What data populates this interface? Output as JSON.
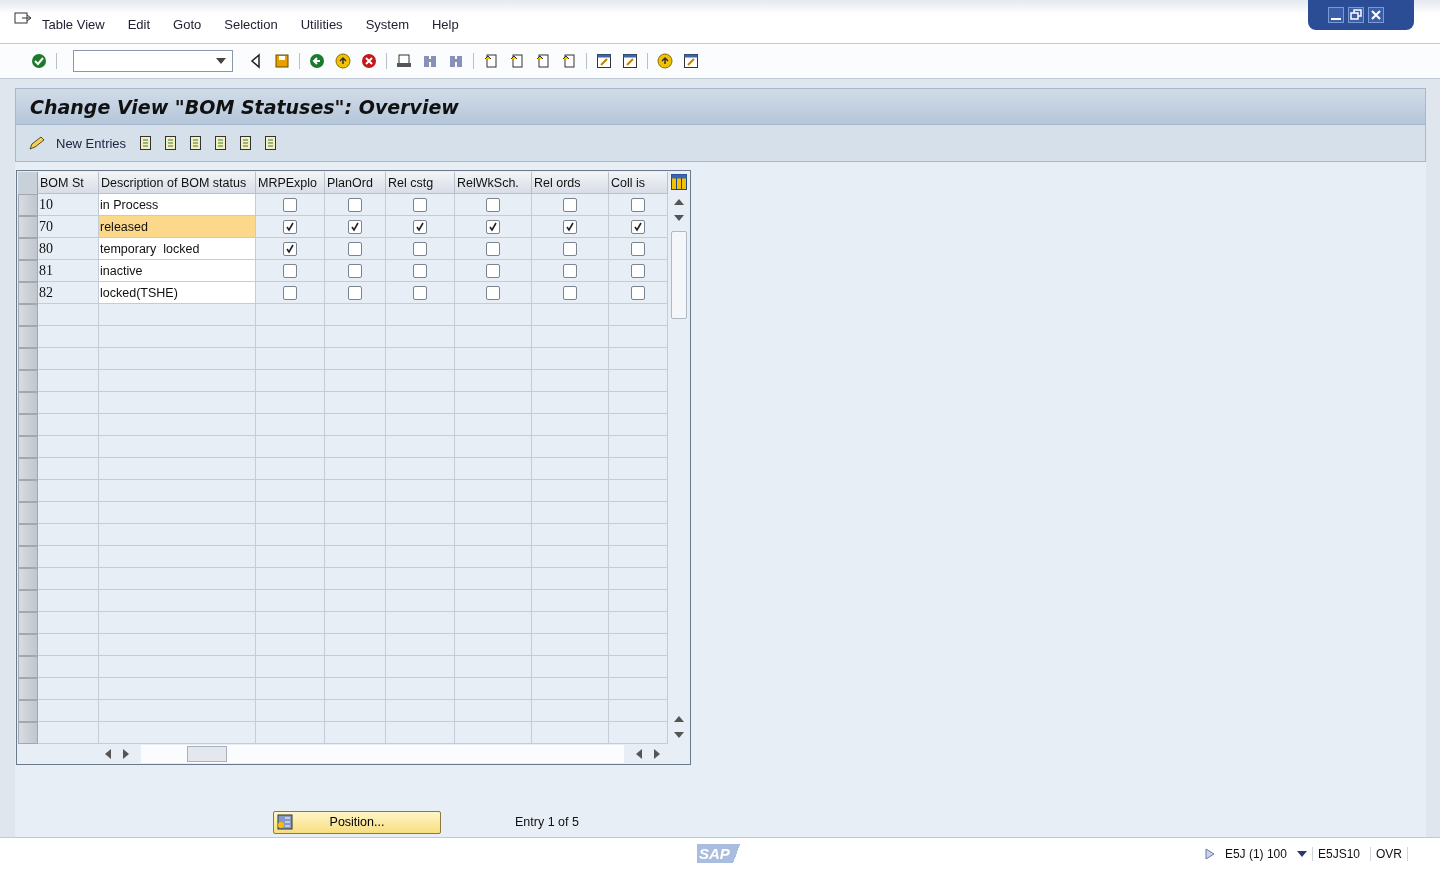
{
  "menu": [
    "Table View",
    "Edit",
    "Goto",
    "Selection",
    "Utilities",
    "System",
    "Help"
  ],
  "title": "Change View \"BOM Statuses\": Overview",
  "app_toolbar": {
    "new_entries": "New Entries"
  },
  "table": {
    "columns": [
      "BOM St",
      "Description of BOM status",
      "MRPExplo",
      "PlanOrd",
      "Rel cstg",
      "RelWkSch.",
      "Rel ords",
      "Coll is"
    ],
    "rows": [
      {
        "bom_st": "10",
        "description": "in Process",
        "selected": false,
        "flags": [
          false,
          false,
          false,
          false,
          false,
          false
        ]
      },
      {
        "bom_st": "70",
        "description": "released",
        "selected": true,
        "flags": [
          true,
          true,
          true,
          true,
          true,
          true
        ]
      },
      {
        "bom_st": "80",
        "description": "temporary  locked",
        "selected": false,
        "flags": [
          true,
          false,
          false,
          false,
          false,
          false
        ]
      },
      {
        "bom_st": "81",
        "description": "inactive",
        "selected": false,
        "flags": [
          false,
          false,
          false,
          false,
          false,
          false
        ]
      },
      {
        "bom_st": "82",
        "description": "locked(TSHE)",
        "selected": false,
        "flags": [
          false,
          false,
          false,
          false,
          false,
          false
        ]
      }
    ]
  },
  "position_button": "Position...",
  "entry_info": "Entry 1 of 5",
  "status_bar": {
    "logo": "SAP",
    "system": "E5J (1) 100",
    "server": "E5JS10",
    "mode": "OVR"
  }
}
